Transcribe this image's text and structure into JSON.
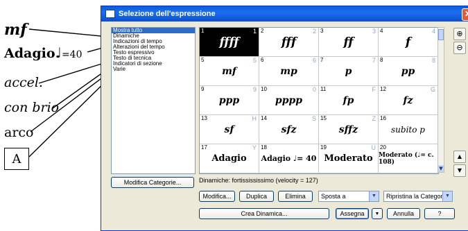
{
  "annotations": {
    "mf": "mf",
    "adagio_word": "Adagio",
    "adagio_note": "♩",
    "adagio_tempo": "=40",
    "accel": "accel.",
    "con_brio": "con brio",
    "arco": "arco",
    "rehearsal": "A"
  },
  "window": {
    "title": "Selezione dell'espressione",
    "close": "✕"
  },
  "categories": [
    "Mostra tutto",
    "Dinamiche",
    "Indicazioni di tempo",
    "Alterazioni del tempo",
    "Testo espressivo",
    "Testo di tecnica",
    "Indicatori di sezione",
    "Varie"
  ],
  "grid": [
    {
      "num": "1",
      "key": "1",
      "sym": "ffff"
    },
    {
      "num": "2",
      "key": "2",
      "sym": "fff"
    },
    {
      "num": "3",
      "key": "3",
      "sym": "ff"
    },
    {
      "num": "4",
      "key": "4",
      "sym": "f"
    },
    {
      "num": "5",
      "key": "5",
      "sym": "mf"
    },
    {
      "num": "6",
      "key": "6",
      "sym": "mp"
    },
    {
      "num": "7",
      "key": "7",
      "sym": "p"
    },
    {
      "num": "8",
      "key": "8",
      "sym": "pp"
    },
    {
      "num": "9",
      "key": "9",
      "sym": "ppp"
    },
    {
      "num": "10",
      "key": "0",
      "sym": "pppp"
    },
    {
      "num": "11",
      "key": "F",
      "sym": "fp"
    },
    {
      "num": "12",
      "key": "G",
      "sym": "fz"
    },
    {
      "num": "13",
      "key": "H",
      "sym": "sf"
    },
    {
      "num": "14",
      "key": "S",
      "sym": "sfz"
    },
    {
      "num": "15",
      "key": "Z",
      "sym": "sffz"
    },
    {
      "num": "16",
      "key": "",
      "sym": "subito p"
    },
    {
      "num": "17",
      "key": "Y",
      "sym": "Adagio"
    },
    {
      "num": "18",
      "key": "",
      "sym": "Adagio ♩= 40"
    },
    {
      "num": "19",
      "key": "U",
      "sym": "Moderato"
    },
    {
      "num": "20",
      "key": "",
      "sym": "Moderato (♩= c. 108)"
    }
  ],
  "status": "Dinamiche: fortissississimo (velocity = 127)",
  "buttons": {
    "modifica_categorie": "Modifica Categorie...",
    "modifica": "Modifica...",
    "duplica": "Duplica",
    "elimina": "Elimina",
    "crea_dinamica": "Crea Dinamica...",
    "assegna": "Assegna",
    "annulla": "Annulla",
    "help": "?"
  },
  "selects": {
    "sposta": "Sposta a",
    "ripristina": "Ripristina la Categori"
  },
  "icons": {
    "zoom_in": "⊕",
    "zoom_out": "⊖",
    "up": "▲",
    "down": "▼"
  }
}
